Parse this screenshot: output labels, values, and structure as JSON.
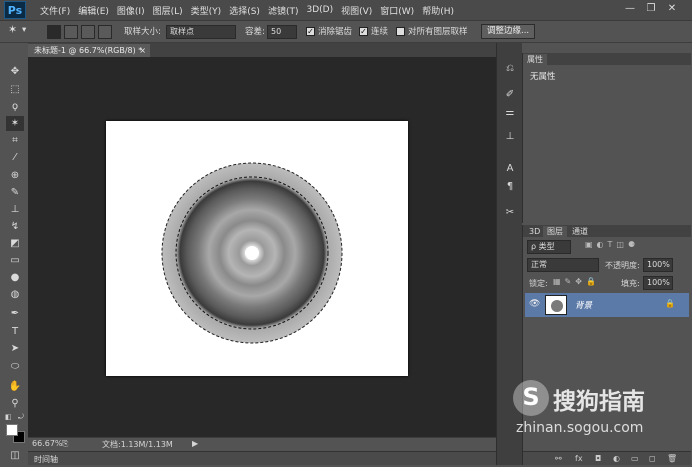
{
  "app": {
    "logo": "Ps"
  },
  "menu": [
    "文件(F)",
    "编辑(E)",
    "图像(I)",
    "图层(L)",
    "类型(Y)",
    "选择(S)",
    "滤镜(T)",
    "3D(D)",
    "视图(V)",
    "窗口(W)",
    "帮助(H)"
  ],
  "window_controls": {
    "minimize": "—",
    "restore": "❐",
    "close": "✕"
  },
  "options": {
    "sample_size_label": "取样大小:",
    "sample_size_value": "取样点",
    "tolerance_label": "容差:",
    "tolerance_value": "50",
    "antialias_label": "消除锯齿",
    "contiguous_label": "连续",
    "sample_all_label": "对所有图层取样",
    "refine_edge_label": "调整边缘..."
  },
  "document_tab": {
    "title": "未标题-1 @ 66.7%(RGB/8) *",
    "close": "×"
  },
  "status": {
    "zoom": "66.67%",
    "doc_info": "文档:1.13M/1.13M"
  },
  "timeline_label": "时间轴",
  "properties_panel": {
    "tab": "属性",
    "content": "无属性"
  },
  "layers_panel": {
    "tabs": [
      "3D",
      "图层",
      "通道"
    ],
    "filter_type": "ρ 类型",
    "blend_mode": "正常",
    "opacity_label": "不透明度:",
    "opacity_value": "100%",
    "lock_label": "锁定:",
    "fill_label": "填充:",
    "fill_value": "100%",
    "layer_name": "背景"
  },
  "footer_icons": [
    "link-icon",
    "fx-icon",
    "mask-icon",
    "adjustment-icon",
    "folder-icon",
    "new-layer-icon",
    "trash-icon"
  ],
  "watermark": {
    "brand": "搜狗指南",
    "url": "zhinan.sogou.com"
  },
  "colors": {
    "accent": "#5c7aa8",
    "canvas_bg": "#282828",
    "panel_bg": "#535353"
  }
}
